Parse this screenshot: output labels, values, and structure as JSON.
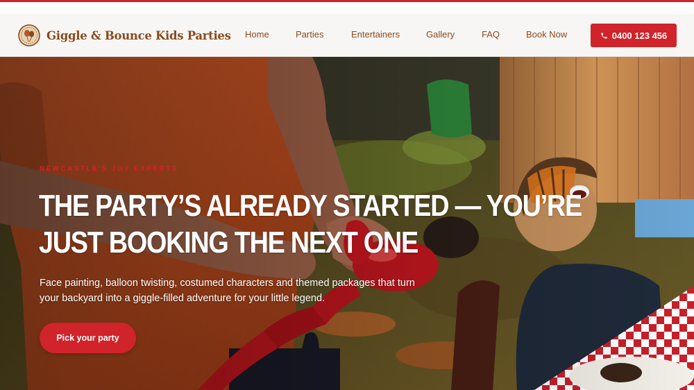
{
  "brand": {
    "name": "Giggle & Bounce Kids Parties",
    "logo_icon": "balloon-badge-icon"
  },
  "nav": {
    "items": [
      {
        "label": "Home"
      },
      {
        "label": "Parties"
      },
      {
        "label": "Entertainers"
      },
      {
        "label": "Gallery"
      },
      {
        "label": "FAQ"
      },
      {
        "label": "Book Now"
      }
    ]
  },
  "call_button": {
    "label": "0400 123 456",
    "icon": "phone-icon"
  },
  "hero": {
    "eyebrow": "NEWCASTLE'S JOY EXPERTS",
    "headline_line1": "The party’s already started — you’re",
    "headline_line2": "just booking the next one",
    "subtext_line1": "Face painting, balloon twisting, costumed characters and themed packages that turn",
    "subtext_line2": "your backyard into a giggle-filled adventure for your little legend.",
    "cta_label": "Pick your party"
  },
  "colors": {
    "accent": "#d0232a",
    "brand_text": "#8a4a1b",
    "header_bg": "#f7f6f4"
  }
}
